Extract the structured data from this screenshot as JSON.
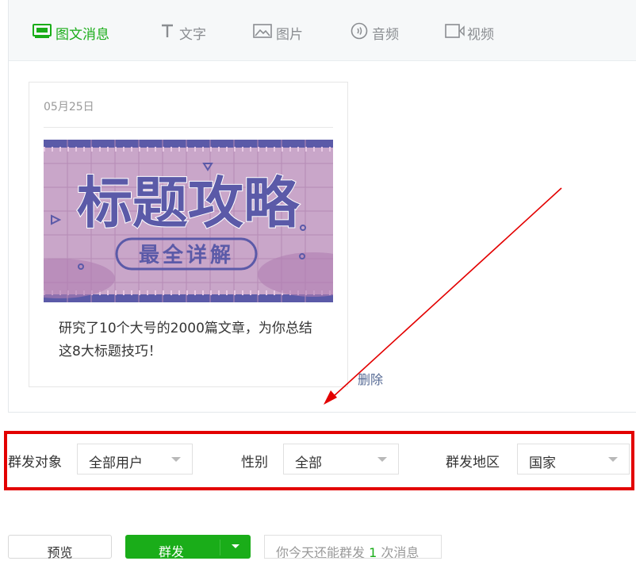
{
  "tabs": [
    {
      "label": "图文消息",
      "icon": "news-icon",
      "active": true
    },
    {
      "label": "文字",
      "icon": "text-icon",
      "active": false
    },
    {
      "label": "图片",
      "icon": "image-icon",
      "active": false
    },
    {
      "label": "音频",
      "icon": "audio-icon",
      "active": false
    },
    {
      "label": "视频",
      "icon": "video-icon",
      "active": false
    }
  ],
  "article": {
    "date": "05月25日",
    "cover_title": "标题攻略",
    "cover_subtitle": "最全详解",
    "caption_line1": "研究了10个大号的2000篇文章，为你总结",
    "caption_line2": "这8大标题技巧！",
    "delete_label": "删除"
  },
  "filters": {
    "target_label": "群发对象",
    "target_value": "全部用户",
    "gender_label": "性别",
    "gender_value": "全部",
    "region_label": "群发地区",
    "region_value": "国家"
  },
  "actions": {
    "preview_label": "预览",
    "send_label": "群发",
    "quota_prefix": "你今天还能群发",
    "quota_count": "1",
    "quota_suffix": "次消息"
  },
  "colors": {
    "accent": "#1aad19",
    "annotation": "#e30000",
    "link": "#576b95",
    "cover_bg": "#c9a6c9",
    "cover_text": "#5b5aa8"
  }
}
